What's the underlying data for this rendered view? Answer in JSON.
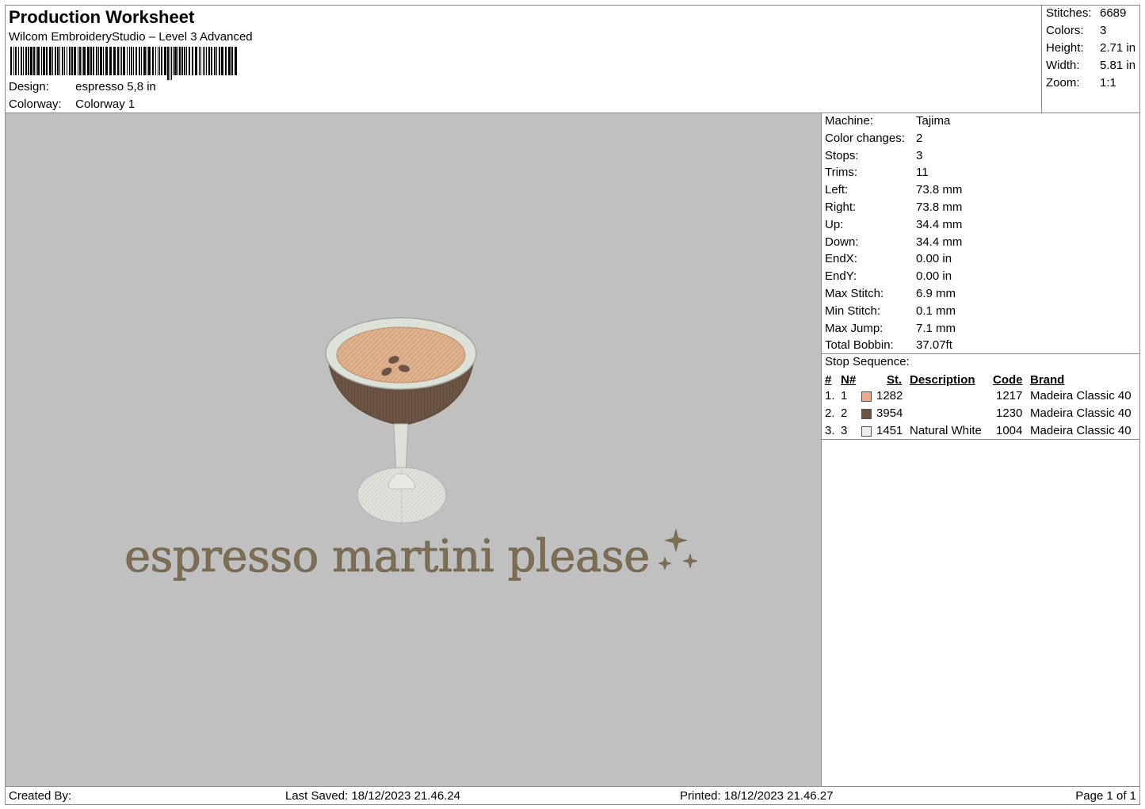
{
  "header": {
    "title": "Production Worksheet",
    "subtitle": "Wilcom EmbroideryStudio – Level 3 Advanced",
    "design_label": "Design:",
    "design_value": "espresso 5,8 in",
    "colorway_label": "Colorway:",
    "colorway_value": "Colorway 1"
  },
  "summary": {
    "stitches_label": "Stitches:",
    "stitches_value": "6689",
    "colors_label": "Colors:",
    "colors_value": "3",
    "height_label": "Height:",
    "height_value": "2.71 in",
    "width_label": "Width:",
    "width_value": "5.81 in",
    "zoom_label": "Zoom:",
    "zoom_value": "1:1"
  },
  "info": [
    {
      "label": "Machine:",
      "value": "Tajima"
    },
    {
      "label": "Color changes:",
      "value": "2"
    },
    {
      "label": "Stops:",
      "value": "3"
    },
    {
      "label": "Trims:",
      "value": "11"
    },
    {
      "label": "Left:",
      "value": "73.8 mm"
    },
    {
      "label": "Right:",
      "value": "73.8 mm"
    },
    {
      "label": "Up:",
      "value": "34.4 mm"
    },
    {
      "label": "Down:",
      "value": "34.4 mm"
    },
    {
      "label": "EndX:",
      "value": "0.00 in"
    },
    {
      "label": "EndY:",
      "value": "0.00 in"
    },
    {
      "label": "Max Stitch:",
      "value": "6.9 mm"
    },
    {
      "label": "Min Stitch:",
      "value": "0.1 mm"
    },
    {
      "label": "Max Jump:",
      "value": "7.1 mm"
    },
    {
      "label": "Total Bobbin:",
      "value": "37.07ft"
    }
  ],
  "stop_sequence": {
    "title": "Stop Sequence:",
    "headers": {
      "num": "#",
      "n": "N#",
      "st": "St.",
      "description": "Description",
      "code": "Code",
      "brand": "Brand"
    },
    "rows": [
      {
        "num": "1.",
        "n": "1",
        "color": "#e8ab90",
        "st": "1282",
        "description": "",
        "code": "1217",
        "brand": "Madeira Classic 40"
      },
      {
        "num": "2.",
        "n": "2",
        "color": "#6b5443",
        "st": "3954",
        "description": "",
        "code": "1230",
        "brand": "Madeira Classic 40"
      },
      {
        "num": "3.",
        "n": "3",
        "color": "#ececec",
        "st": "1451",
        "description": "Natural White",
        "code": "1004",
        "brand": "Madeira Classic 40"
      }
    ]
  },
  "design": {
    "text": "espresso martini please",
    "background_color": "#c0c0c0",
    "foam_color": "#e2b48f",
    "coffee_color": "#6b5443",
    "glass_color": "#dde2d8",
    "text_color": "#7d6e54"
  },
  "footer": {
    "created_by": "Created By:",
    "last_saved": "Last Saved: 18/12/2023 21.46.24",
    "printed": "Printed: 18/12/2023 21.46.27",
    "page": "Page 1 of 1"
  }
}
